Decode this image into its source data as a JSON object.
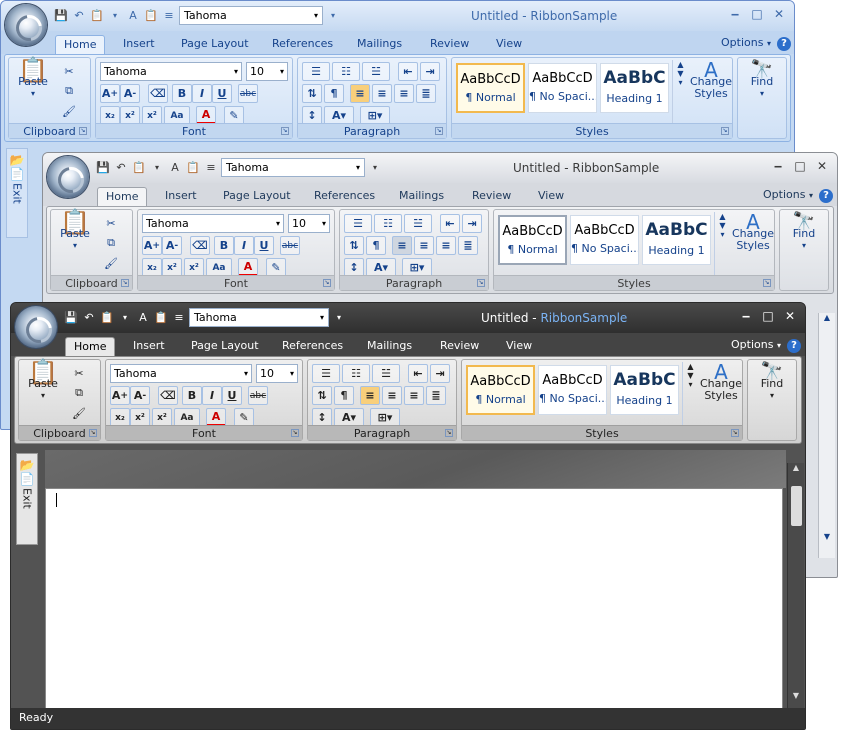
{
  "app": {
    "title_prefix": "Untitled - ",
    "title_name": "RibbonSample",
    "title_full": "Untitled - RibbonSample"
  },
  "font_box": {
    "value": "Tahoma"
  },
  "tabs": [
    "Home",
    "Insert",
    "Page Layout",
    "References",
    "Mailings",
    "Review",
    "View"
  ],
  "options_label": "Options",
  "help_glyph": "?",
  "groups": {
    "clipboard": {
      "label": "Clipboard",
      "paste": "Paste"
    },
    "font": {
      "label": "Font",
      "font_name": "Tahoma",
      "font_size": "10"
    },
    "paragraph": {
      "label": "Paragraph"
    },
    "styles": {
      "label": "Styles",
      "items": [
        {
          "preview": "AaBbCcD",
          "name": "¶ Normal"
        },
        {
          "preview": "AaBbCcD",
          "name": "¶ No Spaci..."
        },
        {
          "preview": "AaBbC",
          "name": "Heading 1"
        }
      ],
      "change_styles": "Change Styles"
    },
    "find": {
      "label": "Find"
    }
  },
  "side_menu": {
    "label": "Exit"
  },
  "status": {
    "text": "Ready"
  },
  "controls": {
    "minimize": "‒",
    "maximize": "□",
    "close": "✕"
  },
  "colors": {
    "blue_theme": "#c4d9f2",
    "silver_theme": "#dfe2e7",
    "black_theme": "#535353",
    "active_style": "#f2b94e"
  }
}
